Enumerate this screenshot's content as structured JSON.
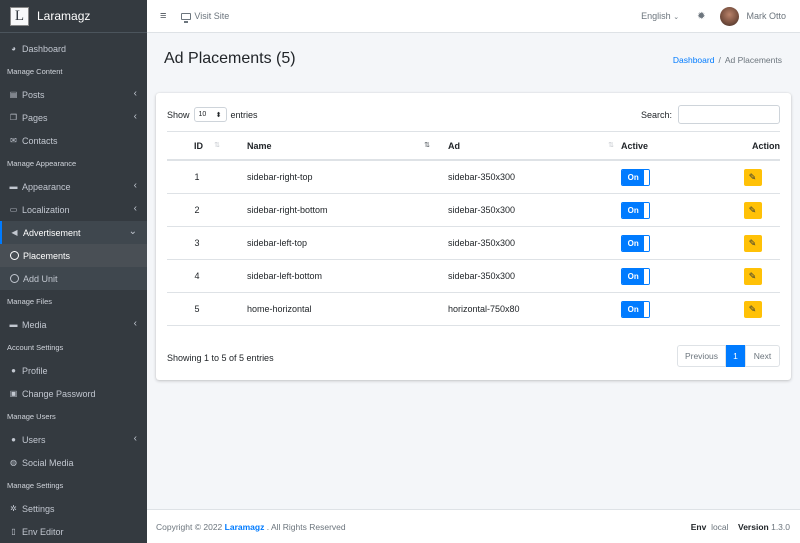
{
  "brand": {
    "logo_letter": "L",
    "name": "Laramagz"
  },
  "sidebar": {
    "items": [
      {
        "type": "item",
        "icon": "tachometer-icon",
        "glyph": "◕",
        "label": "Dashboard"
      },
      {
        "type": "header",
        "label": "Manage Content"
      },
      {
        "type": "item",
        "icon": "file-icon",
        "glyph": "▤",
        "label": "Posts",
        "chevron": "‹"
      },
      {
        "type": "item",
        "icon": "copy-icon",
        "glyph": "❐",
        "label": "Pages",
        "chevron": "‹"
      },
      {
        "type": "item",
        "icon": "envelope-icon",
        "glyph": "✉",
        "label": "Contacts"
      },
      {
        "type": "header",
        "label": "Manage Appearance"
      },
      {
        "type": "item",
        "icon": "paint-roller-icon",
        "glyph": "▬",
        "label": "Appearance",
        "chevron": "‹"
      },
      {
        "type": "item",
        "icon": "language-icon",
        "glyph": "▭",
        "label": "Localization",
        "chevron": "‹"
      },
      {
        "type": "item",
        "icon": "bullhorn-icon",
        "glyph": "◀",
        "label": "Advertisement",
        "chevron": "⌄",
        "open": true
      },
      {
        "type": "sub",
        "label": "Placements",
        "active": true
      },
      {
        "type": "sub",
        "label": "Add Unit"
      },
      {
        "type": "header",
        "label": "Manage Files"
      },
      {
        "type": "item",
        "icon": "photo-icon",
        "glyph": "▬",
        "label": "Media",
        "chevron": "‹"
      },
      {
        "type": "header",
        "label": "Account Settings"
      },
      {
        "type": "item",
        "icon": "user-icon",
        "glyph": "●",
        "label": "Profile"
      },
      {
        "type": "item",
        "icon": "lock-icon",
        "glyph": "▣",
        "label": "Change Password"
      },
      {
        "type": "header",
        "label": "Manage Users"
      },
      {
        "type": "item",
        "icon": "users-icon",
        "glyph": "●",
        "label": "Users",
        "chevron": "‹"
      },
      {
        "type": "item",
        "icon": "globe-icon",
        "glyph": "◍",
        "label": "Social Media"
      },
      {
        "type": "header",
        "label": "Manage Settings"
      },
      {
        "type": "item",
        "icon": "cogs-icon",
        "glyph": "✲",
        "label": "Settings"
      },
      {
        "type": "item",
        "icon": "file-code-icon",
        "glyph": "▯",
        "label": "Env Editor"
      }
    ]
  },
  "topnav": {
    "menu_glyph": "≡",
    "visit_site": "Visit Site",
    "language": "English",
    "language_caret": "⌄",
    "theme_glyph": "✹",
    "user_name": "Mark Otto"
  },
  "header": {
    "title": "Ad Placements (5)",
    "breadcrumb_home": "Dashboard",
    "breadcrumb_sep": "/",
    "breadcrumb_current": "Ad Placements"
  },
  "table_controls": {
    "show_label": "Show",
    "page_size": "10",
    "page_size_caret": "⬍",
    "entries_label": "entries",
    "search_label": "Search:",
    "search_value": ""
  },
  "table": {
    "columns": [
      "ID",
      "Name",
      "Ad",
      "Active",
      "Action"
    ],
    "sort_neutral": "⇅",
    "sort_active": "⇅",
    "rows": [
      {
        "id": "1",
        "name": "sidebar-right-top",
        "ad": "sidebar-350x300",
        "active": "On"
      },
      {
        "id": "2",
        "name": "sidebar-right-bottom",
        "ad": "sidebar-350x300",
        "active": "On"
      },
      {
        "id": "3",
        "name": "sidebar-left-top",
        "ad": "sidebar-350x300",
        "active": "On"
      },
      {
        "id": "4",
        "name": "sidebar-left-bottom",
        "ad": "sidebar-350x300",
        "active": "On"
      },
      {
        "id": "5",
        "name": "home-horizontal",
        "ad": "horizontal-750x80",
        "active": "On"
      }
    ],
    "edit_glyph": "✎"
  },
  "footer_table": {
    "info": "Showing 1 to 5 of 5 entries",
    "prev": "Previous",
    "current_page": "1",
    "next": "Next"
  },
  "footer": {
    "copyright": "Copyright © 2022",
    "brand": "Laramagz",
    "rights": ". All Rights Reserved",
    "env_label": "Env",
    "env_value": "local",
    "version_label": "Version",
    "version_value": "1.3.0"
  },
  "colors": {
    "primary": "#007bff",
    "warning": "#ffc107",
    "sidebar": "#343a40"
  }
}
